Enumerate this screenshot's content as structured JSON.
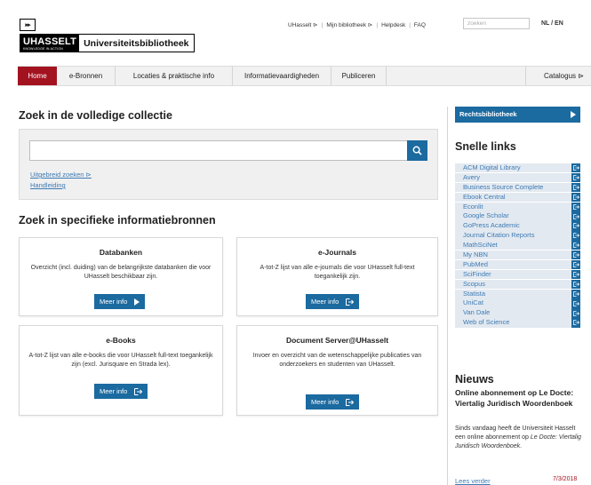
{
  "header": {
    "logo_arrows": "▸▸",
    "logo_name": "UHASSELT",
    "logo_tagline": "KNOWLEDGE IN ACTION",
    "logo_library": "Universiteitsbibliotheek",
    "toplinks": [
      "UHasselt ⊳",
      "Mijn bibliotheek ⊳",
      "Helpdesk",
      "FAQ"
    ],
    "search_placeholder": "zoeken",
    "lang": "NL / EN"
  },
  "nav": {
    "items": [
      "Home",
      "e-Bronnen",
      "Locaties & praktische info",
      "Informatievaardigheden",
      "Publiceren"
    ],
    "right": "Catalogus ⊳"
  },
  "main": {
    "collection_title": "Zoek in de volledige collectie",
    "advanced_link": "Uitgebreid zoeken ⊳",
    "manual_link": "Handleiding",
    "specific_title": "Zoek in specifieke informatiebronnen",
    "cards": [
      {
        "title": "Databanken",
        "desc": "Overzicht (incl. duiding) van de belangrijkste databanken die voor UHasselt beschikbaar zijn.",
        "button": "Meer info"
      },
      {
        "title": "e-Journals",
        "desc": "A-tot-Z lijst van alle e-journals die voor UHasselt full-text toegankelijk zijn.",
        "button": "Meer info"
      },
      {
        "title": "e-Books",
        "desc": "A-tot-Z lijst van alle e-books die voor UHasselt full-text toegankelijk zijn (excl. Jurisquare en Strada lex).",
        "button": "Meer info"
      },
      {
        "title": "Document Server@UHasselt",
        "desc": "Invoer en overzicht van de wetenschappelijke publicaties van onderzoekers en studenten van UHasselt.",
        "button": "Meer info"
      }
    ]
  },
  "sidebar": {
    "rechts_label": "Rechtsbibliotheek",
    "snelle_title": "Snelle links",
    "links": [
      "ACM Digital Library",
      "Avery",
      "Business Source Complete",
      "Ebook Central",
      "Econlit",
      "Google Scholar",
      "GoPress Academic",
      "Journal Citation Reports",
      "MathSciNet",
      "My NBN",
      "PubMed",
      "SciFinder",
      "Scopus",
      "Statista",
      "UniCat",
      "Van Dale",
      "Web of Science"
    ],
    "news_heading": "Nieuws",
    "news_title": "Online abonnement op Le Docte: Viertalig Juridisch Woordenboek",
    "news_body_1": "Sinds vandaag heeft de Universiteit Hasselt een online abonnement op ",
    "news_body_em": "Le Docte: Viertalig Juridisch Woordenboek",
    "news_body_2": ".",
    "read_more": "Lees verder",
    "news_date": "7/3/2018"
  },
  "colors": {
    "brand_red": "#a3121f",
    "accent_blue": "#1b6aa0",
    "link_blue": "#3d7bb5",
    "quicklink_bg": "#e3e9f0"
  }
}
